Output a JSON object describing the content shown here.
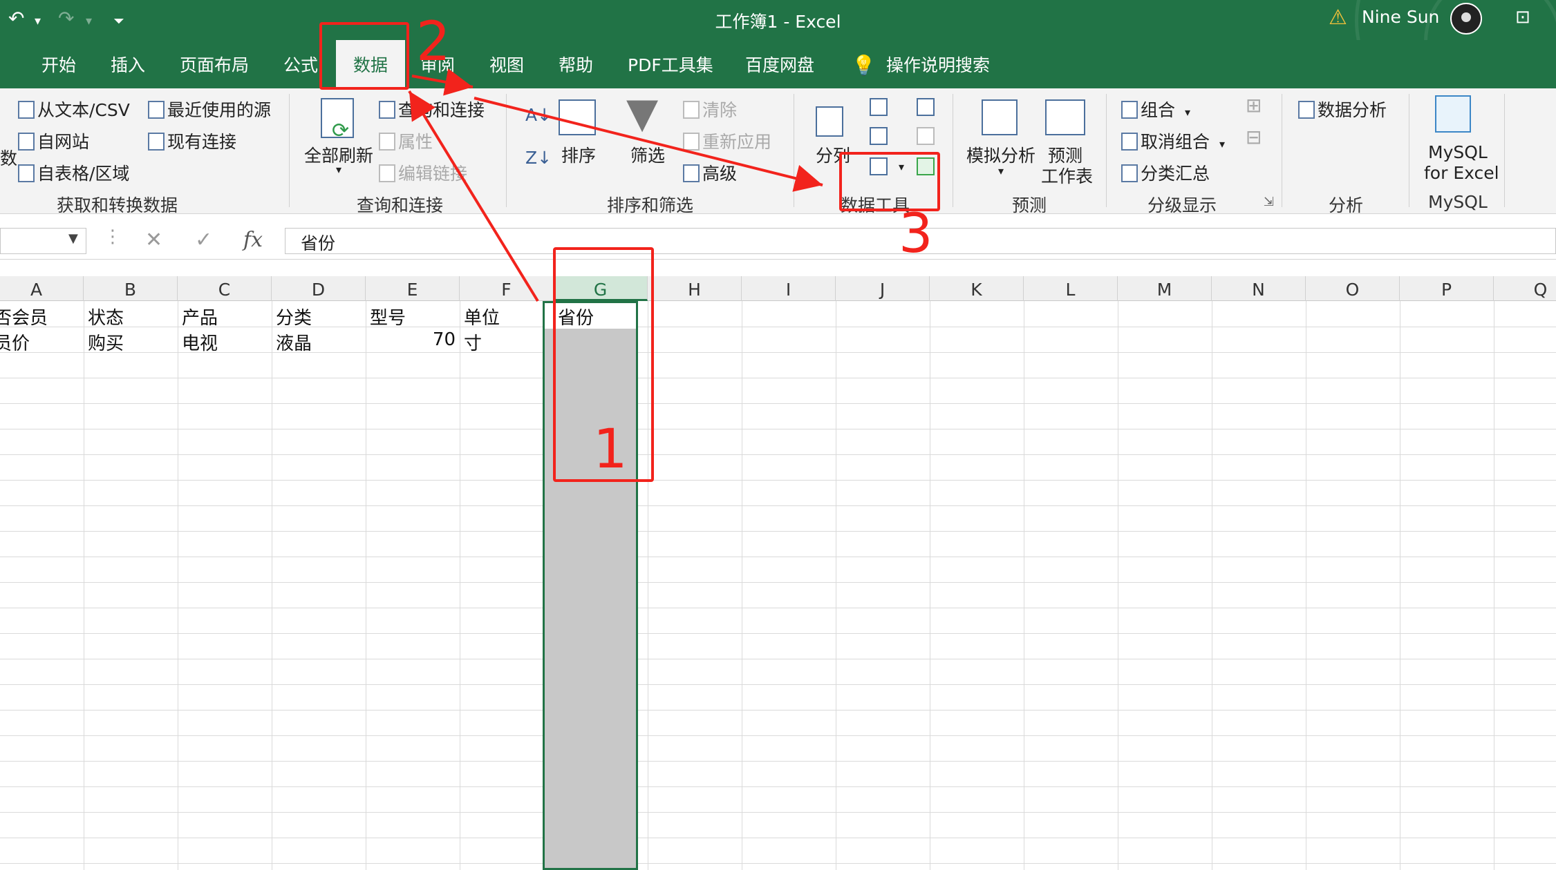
{
  "window": {
    "title": "工作簿1  -  Excel",
    "user": "Nine Sun"
  },
  "quick_access": {
    "undo_icon": "undo-icon",
    "redo_icon": "redo-icon",
    "customize_icon": "customize-qat-icon"
  },
  "tabs": [
    {
      "label": "开始"
    },
    {
      "label": "插入"
    },
    {
      "label": "页面布局"
    },
    {
      "label": "公式"
    },
    {
      "label": "数据",
      "active": true
    },
    {
      "label": "审阅"
    },
    {
      "label": "视图"
    },
    {
      "label": "帮助"
    },
    {
      "label": "PDF工具集"
    },
    {
      "label": "百度网盘"
    },
    {
      "label": "操作说明搜索"
    }
  ],
  "ribbon": {
    "get_data": {
      "from_text_csv": "从文本/CSV",
      "from_web": "自网站",
      "from_table": "自表格/区域",
      "recent_sources": "最近使用的源",
      "existing_connections": "现有连接",
      "left_cut": "数",
      "group_label": "获取和转换数据"
    },
    "queries": {
      "refresh_all": "全部刷新",
      "queries_connections": "查询和连接",
      "properties": "属性",
      "edit_links": "编辑链接",
      "group_label": "查询和连接"
    },
    "sort_filter": {
      "az": "A↓",
      "za": "Z↓",
      "sort": "排序",
      "filter": "筛选",
      "clear": "清除",
      "reapply": "重新应用",
      "advanced": "高级",
      "group_label": "排序和筛选"
    },
    "data_tools": {
      "text_to_columns": "分列",
      "group_label": "数据工具"
    },
    "forecast": {
      "what_if": "模拟分析",
      "forecast_sheet_1": "预测",
      "forecast_sheet_2": "工作表",
      "group_label": "预测"
    },
    "outline": {
      "group": "组合",
      "ungroup": "取消组合",
      "subtotal": "分类汇总",
      "group_label": "分级显示"
    },
    "analysis": {
      "data_analysis": "数据分析",
      "group_label": "分析"
    },
    "mysql": {
      "line1": "MySQL",
      "line2": "for Excel",
      "group_label": "MySQL"
    }
  },
  "formula_bar": {
    "cancel": "✕",
    "enter": "✓",
    "fx": "fx",
    "content": "省份"
  },
  "columns": [
    "A",
    "B",
    "C",
    "D",
    "E",
    "F",
    "G",
    "H",
    "I",
    "J",
    "K",
    "L",
    "M",
    "N",
    "O",
    "P",
    "Q"
  ],
  "selected_column": "G",
  "rows": [
    {
      "A": "否会员",
      "B": "状态",
      "C": "产品",
      "D": "分类",
      "E": "型号",
      "F": "单位",
      "G": "省份"
    },
    {
      "A": "员价",
      "B": "购买",
      "C": "电视",
      "D": "液晶",
      "E": "70",
      "F": "寸"
    }
  ],
  "annotations": {
    "n1": "1",
    "n2": "2",
    "n3": "3",
    "color": "#f2231c"
  }
}
